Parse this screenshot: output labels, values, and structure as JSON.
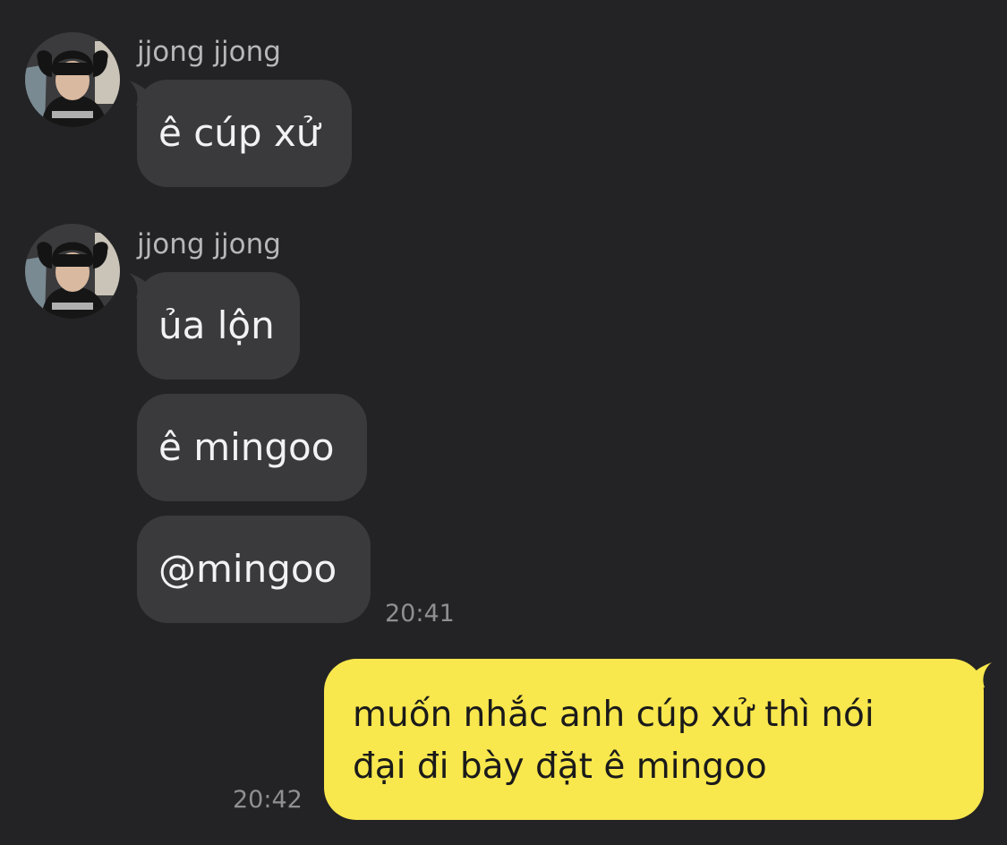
{
  "groups": [
    {
      "sender": "jjong jjong",
      "avatar_icon": "profile-photo-avatar",
      "messages": [
        "ê cúp xử"
      ]
    },
    {
      "sender": "jjong jjong",
      "avatar_icon": "profile-photo-avatar",
      "messages": [
        "ủa lộn",
        "ê mingoo",
        "@mingoo"
      ],
      "time": "20:41"
    }
  ],
  "outgoing": {
    "lines": [
      "muốn nhắc anh cúp xử thì nói",
      "đại đi bày đặt ê mingoo"
    ],
    "time": "20:42"
  },
  "colors": {
    "background": "#232325",
    "incoming_bubble": "#3a3a3c",
    "outgoing_bubble": "#f8e74d"
  }
}
